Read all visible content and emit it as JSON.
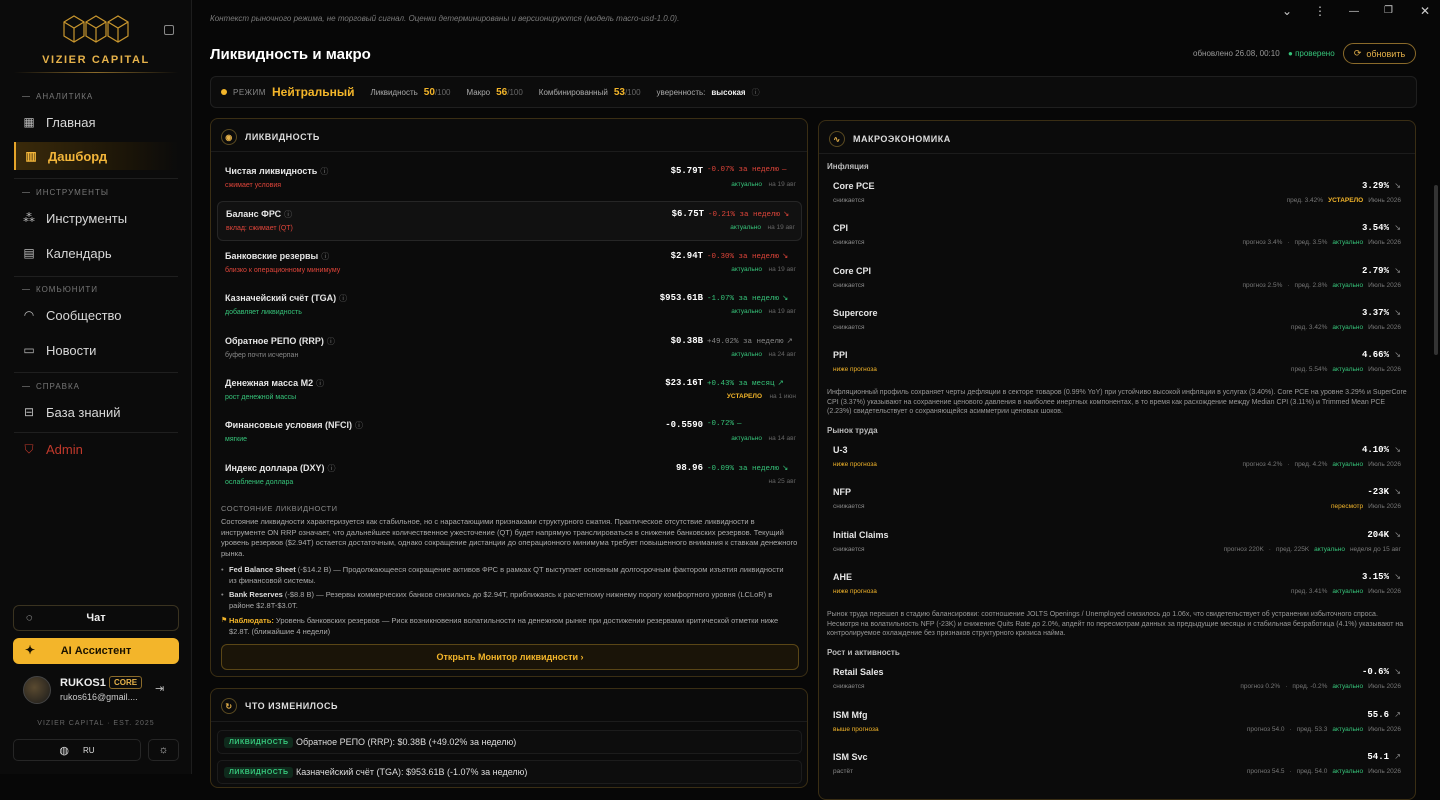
{
  "brand": {
    "name": "VIZIER CAPITAL",
    "est": "VIZIER CAPITAL · EST. 2025"
  },
  "sidebar": {
    "sections": [
      {
        "title": "АНАЛИТИКА"
      },
      {
        "title": "ИНСТРУМЕНТЫ"
      },
      {
        "title": "КОМЬЮНИТИ"
      },
      {
        "title": "СПРАВКА"
      }
    ],
    "items": [
      {
        "label": "Главная",
        "icon": "grid-icon"
      },
      {
        "label": "Дашборд",
        "icon": "bar-chart-icon",
        "active": true
      },
      {
        "label": "Инструменты",
        "icon": "nodes-icon"
      },
      {
        "label": "Календарь",
        "icon": "calendar-icon"
      },
      {
        "label": "Сообщество",
        "icon": "rss-icon"
      },
      {
        "label": "Новости",
        "icon": "news-icon"
      },
      {
        "label": "База знаний",
        "icon": "book-icon"
      },
      {
        "label": "Admin",
        "icon": "shield-icon"
      }
    ],
    "chat_label": "Чат",
    "ai_label": "AI Ассистент",
    "user": {
      "name": "RUKOS1",
      "badge": "CORE",
      "email": "rukos616@gmail...."
    },
    "lang": "RU"
  },
  "header": {
    "note": "Контекст рыночного режима, не торговый сигнал. Оценки детерминированы и версионируются (модель macro-usd-1.0.0).",
    "title": "Ликвидность и макро",
    "updated": "обновлено 26.08, 00:10",
    "verified": "проверено",
    "refresh_label": "обновить"
  },
  "regime": {
    "label": "РЕЖИМ",
    "value": "Нейтральный",
    "liq_label": "Ликвидность",
    "liq_val": "50",
    "macro_label": "Макро",
    "macro_val": "56",
    "comb_label": "Комбинированный",
    "comb_val": "53",
    "den": "/100",
    "conf_label": "уверенность:",
    "conf_val": "высокая"
  },
  "liquidity": {
    "title": "ЛИКВИДНОСТЬ",
    "rows": [
      {
        "name": "Чистая ликвидность",
        "sub": "сжимает условия",
        "sub_color": "#e0453a",
        "value": "$5.79T",
        "change": "-0.07% за неделю",
        "chg_color": "#e0453a",
        "arrow": "—",
        "status": "актуально",
        "date": "на 19 авг"
      },
      {
        "name": "Баланс ФРС",
        "sub": "вклад: сжимает (QT)",
        "sub_color": "#e0453a",
        "value": "$6.75T",
        "change": "-0.21% за неделю",
        "chg_color": "#e0453a",
        "arrow": "↘",
        "status": "актуально",
        "date": "на 19 авг"
      },
      {
        "name": "Банковские резервы",
        "sub": "близко к операционному минимуму",
        "sub_color": "#e0453a",
        "value": "$2.94T",
        "change": "-0.30% за неделю",
        "chg_color": "#e0453a",
        "arrow": "↘",
        "status": "актуально",
        "date": "на 19 авг"
      },
      {
        "name": "Казначейский счёт (TGA)",
        "sub": "добавляет ликвидность",
        "sub_color": "#36c47a",
        "value": "$953.61B",
        "change": "-1.07% за неделю",
        "chg_color": "#36c47a",
        "arrow": "↘",
        "status": "актуально",
        "date": "на 19 авг"
      },
      {
        "name": "Обратное РЕПО (RRP)",
        "sub": "буфер почти исчерпан",
        "sub_color": "#888888",
        "value": "$0.38B",
        "change": "+49.02% за неделю",
        "chg_color": "#888888",
        "arrow": "↗",
        "status": "актуально",
        "date": "на 24 авг"
      },
      {
        "name": "Денежная масса M2",
        "sub": "рост денежной массы",
        "sub_color": "#36c47a",
        "value": "$23.16T",
        "change": "+0.43% за месяц",
        "chg_color": "#36c47a",
        "arrow": "↗",
        "status": "УСТАРЕЛО",
        "date": "на 1 июн"
      },
      {
        "name": "Финансовые условия (NFCI)",
        "sub": "мягкие",
        "sub_color": "#36c47a",
        "value": "-0.5590",
        "change": "-0.72%",
        "chg_color": "#36c47a",
        "arrow": "—",
        "status": "актуально",
        "date": "на 14 авг"
      },
      {
        "name": "Индекс доллара (DXY)",
        "sub": "ослабление доллара",
        "sub_color": "#36c47a",
        "value": "98.96",
        "change": "-0.09% за неделю",
        "chg_color": "#36c47a",
        "arrow": "↘",
        "status": "",
        "date": "на 25 авг"
      }
    ],
    "state_title": "СОСТОЯНИЕ ЛИКВИДНОСТИ",
    "state_text": "Состояние ликвидности характеризуется как стабильное, но с нарастающими признаками структурного сжатия. Практическое отсутствие ликвидности в инструменте ON RRP означает, что дальнейшее количественное ужесточение (QT) будет напрямую транслироваться в снижение банковских резервов. Текущий уровень резервов ($2.94T) остается достаточным, однако сокращение дистанции до операционного минимума требует повышенного внимания к ставкам денежного рынка.",
    "bullets": [
      {
        "bold": "Fed Balance Sheet",
        "text": " (-$14.2 B) — Продолжающееся сокращение активов ФРС в рамках QT выступает основным долгосрочным фактором изъятия ликвидности из финансовой системы."
      },
      {
        "bold": "Bank Reserves",
        "text": " (-$8.8 B) — Резервы коммерческих банков снизились до $2.94T, приближаясь к расчетному нижнему порогу комфортного уровня (LCLoR) в районе $2.8T-$3.0T."
      },
      {
        "bold": "Наблюдать:",
        "text": " Уровень банковских резервов — Риск возникновения волатильности на денежном рынке при достижении резервами критической отметки ниже $2.8T. (ближайшие 4 недели)"
      }
    ],
    "open_label": "Открыть Монитор ликвидности ›"
  },
  "changes": {
    "title": "ЧТО ИЗМЕНИЛОСЬ",
    "rows": [
      {
        "tag": "ЛИКВИДНОСТЬ",
        "text": "Обратное РЕПО (RRP): $0.38B (+49.02% за неделю)"
      },
      {
        "tag": "ЛИКВИДНОСТЬ",
        "text": "Казначейский счёт (TGA): $953.61B (-1.07% за неделю)"
      }
    ]
  },
  "macro": {
    "title": "МАКРОЭКОНОМИКА",
    "groups": [
      {
        "title": "Инфляция"
      },
      {
        "title": "Рынок труда"
      },
      {
        "title": "Рост и активность"
      }
    ],
    "rows": [
      {
        "name": "Core PCE",
        "sub": "снижается",
        "value": "3.29%",
        "arrow": "↘",
        "forecast": "",
        "prev": "пред. 3.42%",
        "status": "УСТАРЕЛО",
        "date": "Июнь 2026"
      },
      {
        "name": "CPI",
        "sub": "снижается",
        "value": "3.54%",
        "arrow": "↘",
        "forecast": "прогноз 3.4%",
        "prev": "пред. 3.5%",
        "status": "актуально",
        "date": "Июль 2026"
      },
      {
        "name": "Core CPI",
        "sub": "снижается",
        "value": "2.79%",
        "arrow": "↘",
        "forecast": "прогноз 2.5%",
        "prev": "пред. 2.8%",
        "status": "актуально",
        "date": "Июль 2026"
      },
      {
        "name": "Supercore",
        "sub": "снижается",
        "value": "3.37%",
        "arrow": "↘",
        "forecast": "",
        "prev": "пред. 3.42%",
        "status": "актуально",
        "date": "Июль 2026"
      },
      {
        "name": "PPI",
        "sub": "ниже прогноза",
        "value": "4.66%",
        "arrow": "↘",
        "forecast": "",
        "prev": "пред. 5.54%",
        "status": "актуально",
        "date": "Июль 2026"
      },
      {
        "name": "U-3",
        "sub": "ниже прогноза",
        "value": "4.10%",
        "arrow": "↘",
        "forecast": "прогноз 4.2%",
        "prev": "пред. 4.2%",
        "status": "актуально",
        "date": "Июль 2026"
      },
      {
        "name": "NFP",
        "sub": "снижается",
        "value": "-23K",
        "arrow": "↘",
        "forecast": "",
        "prev": "",
        "status": "пересмотр",
        "date": "Июль 2026"
      },
      {
        "name": "Initial Claims",
        "sub": "снижается",
        "value": "204K",
        "arrow": "↘",
        "forecast": "прогноз 220K",
        "prev": "пред. 225K",
        "status": "актуально",
        "date": "неделя до 15 авг"
      },
      {
        "name": "AHE",
        "sub": "ниже прогноза",
        "value": "3.15%",
        "arrow": "↘",
        "forecast": "",
        "prev": "пред. 3.41%",
        "status": "актуально",
        "date": "Июль 2026"
      },
      {
        "name": "Retail Sales",
        "sub": "снижается",
        "value": "-0.6%",
        "arrow": "↘",
        "forecast": "прогноз 0.2%",
        "prev": "пред. -0.2%",
        "status": "актуально",
        "date": "Июль 2026"
      },
      {
        "name": "ISM Mfg",
        "sub": "выше прогноза",
        "value": "55.6",
        "arrow": "↗",
        "forecast": "прогноз 54.0",
        "prev": "пред. 53.3",
        "status": "актуально",
        "date": "Июль 2026"
      },
      {
        "name": "ISM Svc",
        "sub": "растёт",
        "value": "54.1",
        "arrow": "↗",
        "forecast": "прогноз 54.5",
        "prev": "пред. 54.0",
        "status": "актуально",
        "date": "Июль 2026"
      }
    ],
    "infl_text": "Инфляционный профиль сохраняет черты дефляции в секторе товаров (0.99% YoY) при устойчиво высокой инфляции в услугах (3.40%). Core PCE на уровне 3.29% и SuperCore CPI (3.37%) указывают на сохранение ценового давления в наиболее инертных компонентах, в то время как расхождение между Median CPI (3.11%) и Trimmed Mean PCE (2.23%) свидетельствует о сохраняющейся асимметрии ценовых шоков.",
    "labor_text": "Рынок труда перешел в стадию балансировки: соотношение JOLTS Openings / Unemployed снизилось до 1.06x, что свидетельствует об устранении избыточного спроса. Несмотря на волатильность NFP (-23K) и снижение Quits Rate до 2.0%, апдейт по пересмотрам данных за предыдущие месяцы и стабильная безработица (4.1%) указывают на контролируемое охлаждение без признаков структурного кризиса найма."
  }
}
